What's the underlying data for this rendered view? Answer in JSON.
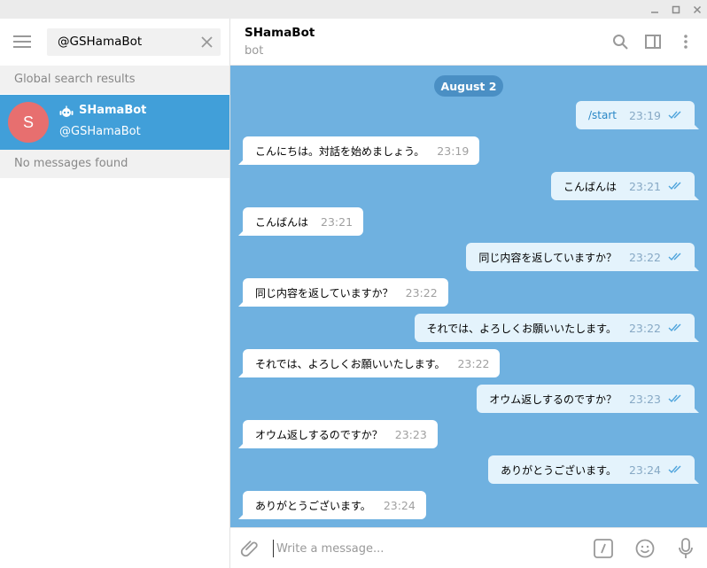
{
  "window": {
    "controls": [
      "minimize-icon",
      "maximize-icon",
      "close-icon"
    ]
  },
  "sidebar": {
    "search": {
      "value": "@GSHamaBot",
      "placeholder": "Search"
    },
    "global_label": "Global search results",
    "result": {
      "avatar_letter": "S",
      "name": "SHamaBot",
      "username": "@GSHamaBot"
    },
    "no_messages_label": "No messages found"
  },
  "chat": {
    "title": "SHamaBot",
    "status": "bot",
    "date": "August 2",
    "messages": [
      {
        "dir": "out",
        "text": "/start",
        "time": "23:19"
      },
      {
        "dir": "in",
        "text": "こんにちは。対話を始めましょう。",
        "time": "23:19"
      },
      {
        "dir": "out",
        "text": "こんばんは",
        "time": "23:21"
      },
      {
        "dir": "in",
        "text": "こんばんは",
        "time": "23:21"
      },
      {
        "dir": "out",
        "text": "同じ内容を返していますか？",
        "time": "23:22"
      },
      {
        "dir": "in",
        "text": "同じ内容を返していますか？",
        "time": "23:22"
      },
      {
        "dir": "out",
        "text": "それでは、よろしくお願いいたします。",
        "time": "23:22"
      },
      {
        "dir": "in",
        "text": "それでは、よろしくお願いいたします。",
        "time": "23:22"
      },
      {
        "dir": "out",
        "text": "オウム返しするのですか？",
        "time": "23:23"
      },
      {
        "dir": "in",
        "text": "オウム返しするのですか？",
        "time": "23:23"
      },
      {
        "dir": "out",
        "text": "ありがとうございます。",
        "time": "23:24"
      },
      {
        "dir": "in",
        "text": "ありがとうございます。",
        "time": "23:24"
      }
    ]
  },
  "compose": {
    "placeholder": "Write a message..."
  },
  "colors": {
    "accent": "#419fd9",
    "chat_background": "#6fb1e0",
    "date_pill": "#4a8fc4",
    "avatar": "#e76f6f",
    "outgoing_bubble": "#e4f3fc",
    "incoming_bubble": "#ffffff",
    "read_ticks": "#4ea4dc"
  }
}
